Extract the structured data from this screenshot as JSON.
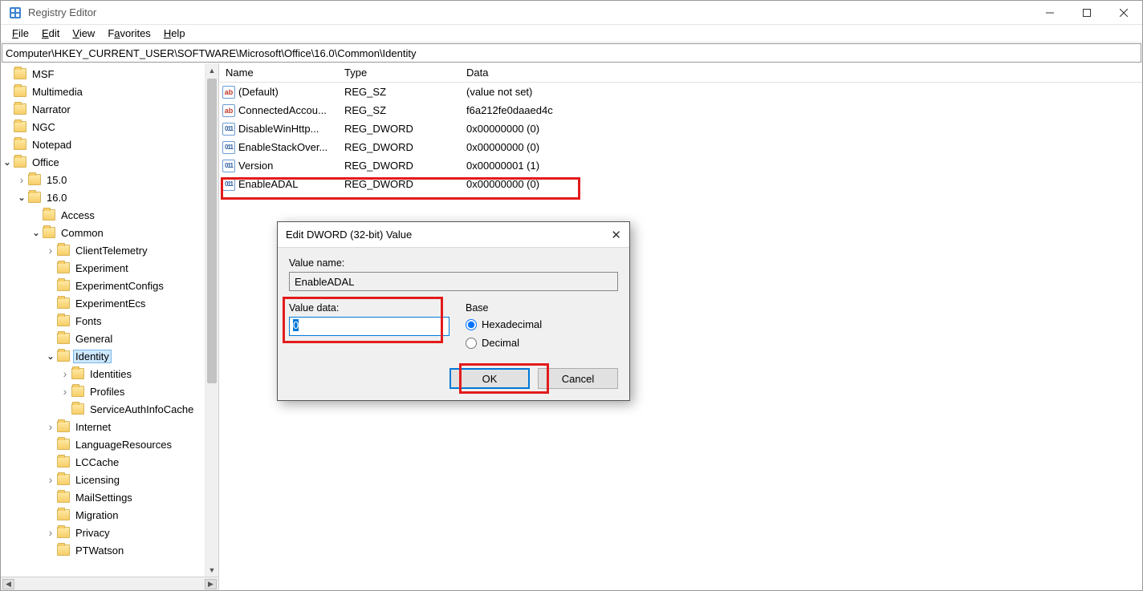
{
  "window": {
    "title": "Registry Editor"
  },
  "menu": {
    "file": "File",
    "edit": "Edit",
    "view": "View",
    "favorites": "Favorites",
    "help": "Help"
  },
  "address": "Computer\\HKEY_CURRENT_USER\\SOFTWARE\\Microsoft\\Office\\16.0\\Common\\Identity",
  "tree": [
    {
      "indent": 0,
      "arrow": "",
      "name": "MSF"
    },
    {
      "indent": 0,
      "arrow": "",
      "name": "Multimedia"
    },
    {
      "indent": 0,
      "arrow": "",
      "name": "Narrator"
    },
    {
      "indent": 0,
      "arrow": "",
      "name": "NGC"
    },
    {
      "indent": 0,
      "arrow": "",
      "name": "Notepad"
    },
    {
      "indent": 0,
      "arrow": "open",
      "name": "Office"
    },
    {
      "indent": 1,
      "arrow": "closed",
      "name": "15.0"
    },
    {
      "indent": 1,
      "arrow": "open",
      "name": "16.0"
    },
    {
      "indent": 2,
      "arrow": "",
      "name": "Access"
    },
    {
      "indent": 2,
      "arrow": "open",
      "name": "Common"
    },
    {
      "indent": 3,
      "arrow": "closed",
      "name": "ClientTelemetry"
    },
    {
      "indent": 3,
      "arrow": "",
      "name": "Experiment"
    },
    {
      "indent": 3,
      "arrow": "",
      "name": "ExperimentConfigs"
    },
    {
      "indent": 3,
      "arrow": "",
      "name": "ExperimentEcs"
    },
    {
      "indent": 3,
      "arrow": "",
      "name": "Fonts"
    },
    {
      "indent": 3,
      "arrow": "",
      "name": "General"
    },
    {
      "indent": 3,
      "arrow": "open",
      "name": "Identity",
      "selected": true
    },
    {
      "indent": 4,
      "arrow": "closed",
      "name": "Identities"
    },
    {
      "indent": 4,
      "arrow": "closed",
      "name": "Profiles"
    },
    {
      "indent": 4,
      "arrow": "",
      "name": "ServiceAuthInfoCache"
    },
    {
      "indent": 3,
      "arrow": "closed",
      "name": "Internet"
    },
    {
      "indent": 3,
      "arrow": "",
      "name": "LanguageResources"
    },
    {
      "indent": 3,
      "arrow": "",
      "name": "LCCache"
    },
    {
      "indent": 3,
      "arrow": "closed",
      "name": "Licensing"
    },
    {
      "indent": 3,
      "arrow": "",
      "name": "MailSettings"
    },
    {
      "indent": 3,
      "arrow": "",
      "name": "Migration"
    },
    {
      "indent": 3,
      "arrow": "closed",
      "name": "Privacy"
    },
    {
      "indent": 3,
      "arrow": "",
      "name": "PTWatson"
    }
  ],
  "list": {
    "headers": {
      "name": "Name",
      "type": "Type",
      "data": "Data"
    },
    "rows": [
      {
        "icon": "sz",
        "name": "(Default)",
        "type": "REG_SZ",
        "data": "(value not set)"
      },
      {
        "icon": "sz",
        "name": "ConnectedAccou...",
        "type": "REG_SZ",
        "data": "f6a212fe0daaed4c"
      },
      {
        "icon": "bin",
        "name": "DisableWinHttp...",
        "type": "REG_DWORD",
        "data": "0x00000000 (0)"
      },
      {
        "icon": "bin",
        "name": "EnableStackOver...",
        "type": "REG_DWORD",
        "data": "0x00000000 (0)"
      },
      {
        "icon": "bin",
        "name": "Version",
        "type": "REG_DWORD",
        "data": "0x00000001 (1)"
      },
      {
        "icon": "bin",
        "name": "EnableADAL",
        "type": "REG_DWORD",
        "data": "0x00000000 (0)"
      }
    ]
  },
  "dialog": {
    "title": "Edit DWORD (32-bit) Value",
    "valueNameLabel": "Value name:",
    "valueName": "EnableADAL",
    "valueDataLabel": "Value data:",
    "valueData": "0",
    "baseLabel": "Base",
    "hex": "Hexadecimal",
    "dec": "Decimal",
    "ok": "OK",
    "cancel": "Cancel"
  }
}
